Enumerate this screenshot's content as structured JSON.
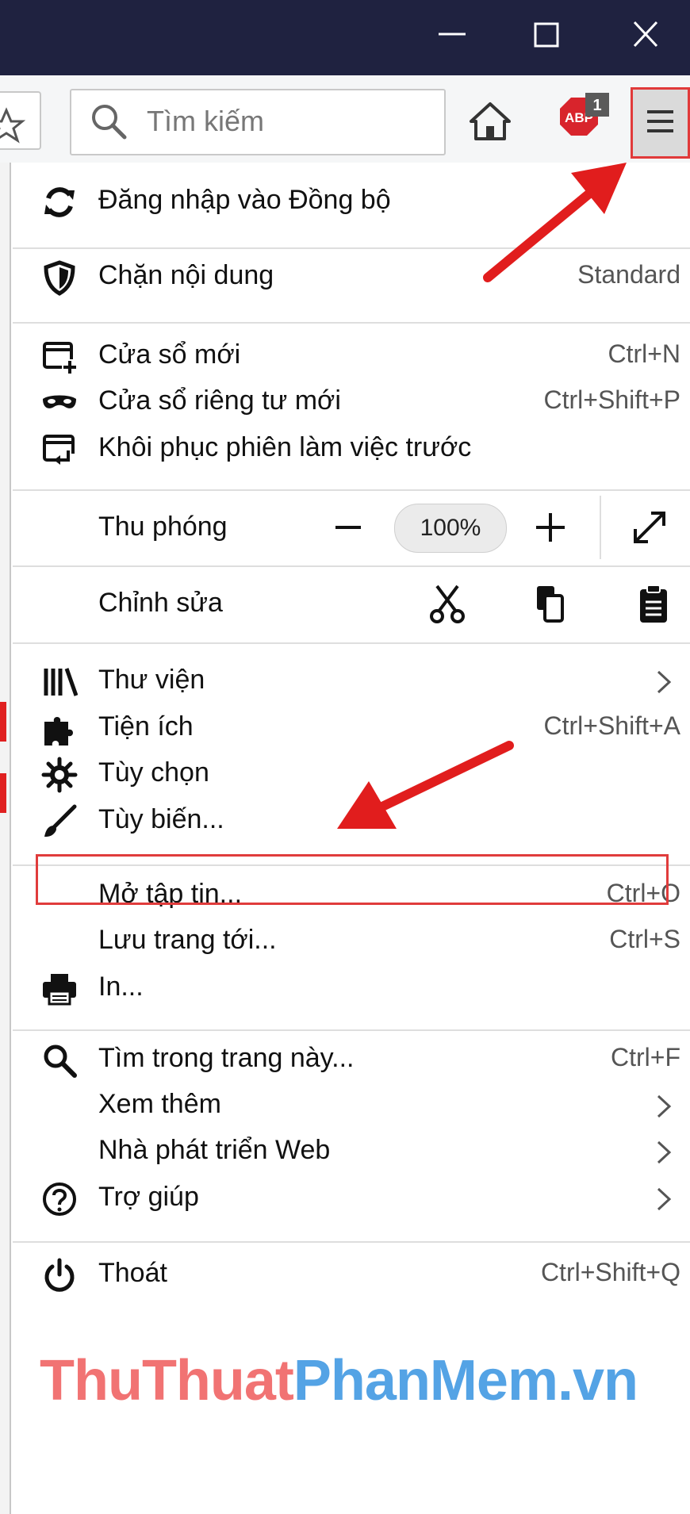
{
  "toolbar": {
    "search_placeholder": "Tìm kiếm",
    "adblock_badge": "1",
    "adblock_label": "ABP"
  },
  "menu": {
    "sync": {
      "label": "Đăng nhập vào Đồng bộ"
    },
    "content_blocking": {
      "label": "Chặn nội dung",
      "value": "Standard"
    },
    "new_window": {
      "label": "Cửa sổ mới",
      "shortcut": "Ctrl+N"
    },
    "private_window": {
      "label": "Cửa sổ riêng tư mới",
      "shortcut": "Ctrl+Shift+P"
    },
    "restore_session": {
      "label": "Khôi phục phiên làm việc trước"
    },
    "zoom": {
      "label": "Thu phóng",
      "value": "100%"
    },
    "edit": {
      "label": "Chỉnh sửa"
    },
    "library": {
      "label": "Thư viện"
    },
    "addons": {
      "label": "Tiện ích",
      "shortcut": "Ctrl+Shift+A"
    },
    "options": {
      "label": "Tùy chọn"
    },
    "customize": {
      "label": "Tùy biến..."
    },
    "open_file": {
      "label": "Mở tập tin...",
      "shortcut": "Ctrl+O"
    },
    "save_page": {
      "label": "Lưu trang tới...",
      "shortcut": "Ctrl+S"
    },
    "print": {
      "label": "In..."
    },
    "find": {
      "label": "Tìm trong trang này...",
      "shortcut": "Ctrl+F"
    },
    "more": {
      "label": "Xem thêm"
    },
    "web_developer": {
      "label": "Nhà phát triển Web"
    },
    "help": {
      "label": "Trợ giúp"
    },
    "quit": {
      "label": "Thoát",
      "shortcut": "Ctrl+Shift+Q"
    }
  },
  "watermark": {
    "part1": "ThuThuat",
    "part2": "PhanMem.vn"
  },
  "colors": {
    "titlebar": "#1f2240",
    "highlight_red": "#e13a3a",
    "watermark_red": "#ef5555",
    "watermark_blue": "#2f8fe0"
  }
}
